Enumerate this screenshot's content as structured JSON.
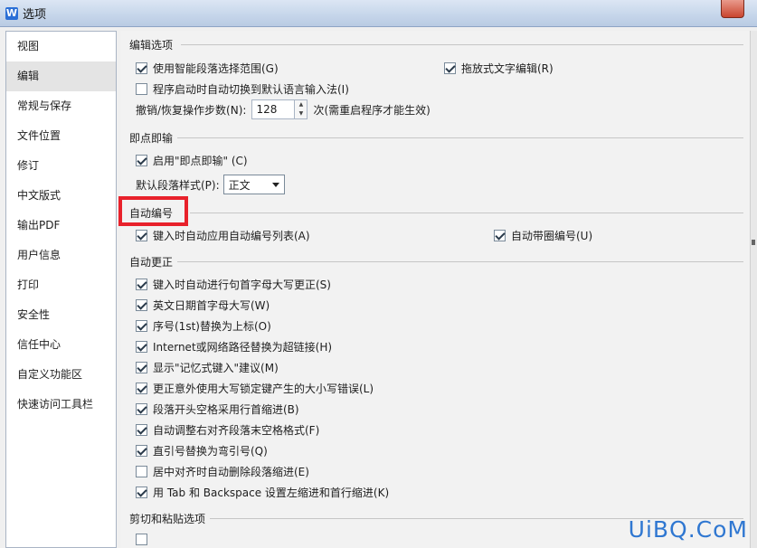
{
  "window": {
    "title": "选项",
    "logo_letter": "W"
  },
  "sidebar": {
    "items": [
      {
        "label": "视图"
      },
      {
        "label": "编辑"
      },
      {
        "label": "常规与保存"
      },
      {
        "label": "文件位置"
      },
      {
        "label": "修订"
      },
      {
        "label": "中文版式"
      },
      {
        "label": "输出PDF"
      },
      {
        "label": "用户信息"
      },
      {
        "label": "打印"
      },
      {
        "label": "安全性"
      },
      {
        "label": "信任中心"
      },
      {
        "label": "自定义功能区"
      },
      {
        "label": "快速访问工具栏"
      }
    ],
    "active_index": 1
  },
  "edit_options": {
    "header": "编辑选项",
    "smart_paragraph": {
      "label": "使用智能段落选择范围(G)",
      "checked": true
    },
    "drag_text": {
      "label": "拖放式文字编辑(R)",
      "checked": true
    },
    "auto_ime": {
      "label": "程序启动时自动切换到默认语言输入法(I)",
      "checked": false
    },
    "undo_label": "撤销/恢复操作步数(N):",
    "undo_value": "128",
    "undo_suffix": "次(需重启程序才能生效)"
  },
  "click_type": {
    "header": "即点即输",
    "enable": {
      "label": "启用\"即点即输\" (C)",
      "checked": true
    },
    "style_label": "默认段落样式(P):",
    "style_value": "正文"
  },
  "auto_number": {
    "header": "自动编号",
    "auto_list": {
      "label": "键入时自动应用自动编号列表(A)",
      "checked": true
    },
    "circle_number": {
      "label": "自动带圈编号(U)",
      "checked": true
    }
  },
  "auto_correct": {
    "header": "自动更正",
    "items": [
      {
        "label": "键入时自动进行句首字母大写更正(S)",
        "checked": true
      },
      {
        "label": "英文日期首字母大写(W)",
        "checked": true
      },
      {
        "label": "序号(1st)替换为上标(O)",
        "checked": true
      },
      {
        "label": "Internet或网络路径替换为超链接(H)",
        "checked": true
      },
      {
        "label": "显示\"记忆式键入\"建议(M)",
        "checked": true
      },
      {
        "label": "更正意外使用大写锁定键产生的大小写错误(L)",
        "checked": true
      },
      {
        "label": "段落开头空格采用行首缩进(B)",
        "checked": true
      },
      {
        "label": "自动调整右对齐段落末空格格式(F)",
        "checked": true
      },
      {
        "label": "直引号替换为弯引号(Q)",
        "checked": true
      },
      {
        "label": "居中对齐时自动删除段落缩进(E)",
        "checked": false
      },
      {
        "label": "用 Tab 和 Backspace 设置左缩进和首行缩进(K)",
        "checked": true
      }
    ]
  },
  "cut_paste": {
    "header": "剪切和粘贴选项"
  },
  "watermark": "UiBQ.CoM"
}
